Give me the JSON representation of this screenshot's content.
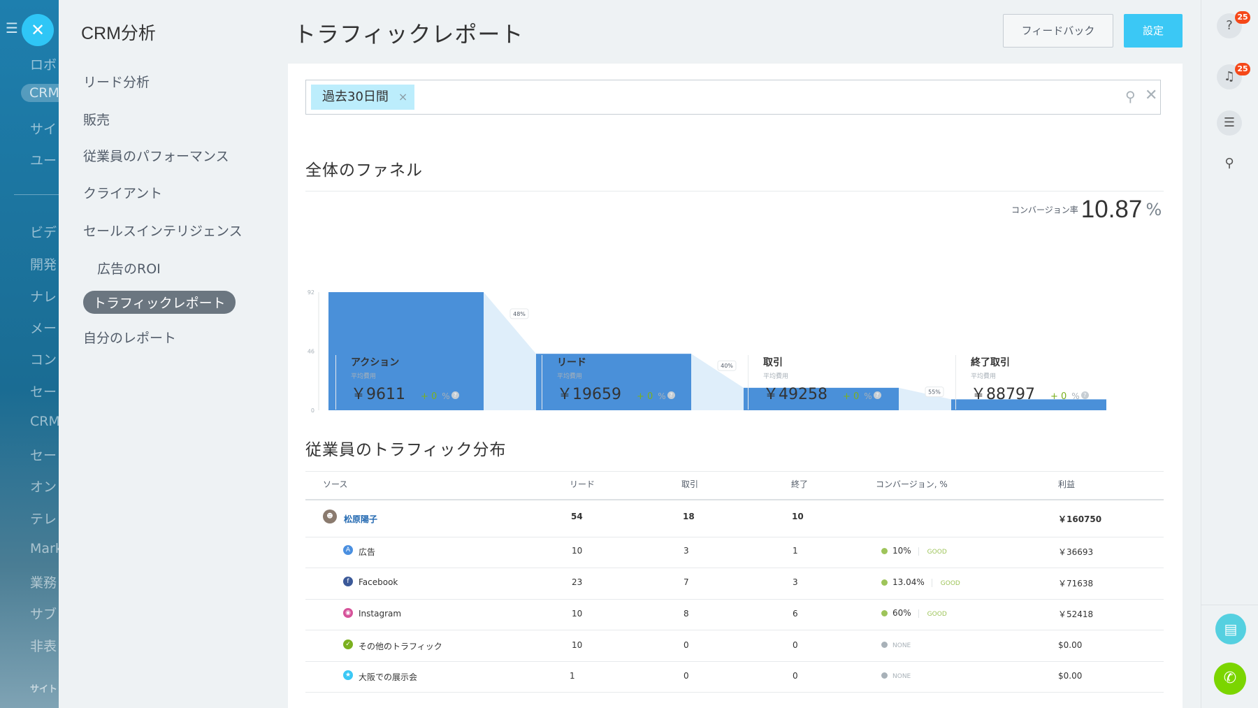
{
  "left_nav": {
    "items": [
      "ロボ",
      "CRM",
      "サイ",
      "ユー",
      "ビデ",
      "開発",
      "ナレ",
      "メー",
      "コン",
      "セー",
      "CRM",
      "セー",
      "オン",
      "テレ",
      "Mark",
      "業務",
      "サブ",
      "非表"
    ],
    "bottom": "サイト"
  },
  "submenu": {
    "title": "CRM分析",
    "items": [
      "リード分析",
      "販売",
      "従業員のパフォーマンス",
      "クライアント",
      "セールスインテリジェンス",
      "広告のROI",
      "トラフィックレポート",
      "自分のレポート"
    ],
    "active": "トラフィックレポート"
  },
  "header": {
    "title": "トラフィックレポート",
    "feedback_label": "フィードバック",
    "settings_label": "設定"
  },
  "right_rail": {
    "help_badge": "25",
    "notifications_badge": "25"
  },
  "filter": {
    "chip_label": "過去30日間",
    "chip_remove": "×"
  },
  "funnel": {
    "section_title": "全体のファネル",
    "conversion_label": "コンバージョン率",
    "conversion_value": "10.87",
    "conversion_unit": "%",
    "stages": [
      {
        "name": "アクション",
        "sub": "平均費用",
        "amount": "￥9611",
        "delta": "+ 0",
        "pct": "%"
      },
      {
        "name": "リード",
        "sub": "平均費用",
        "amount": "￥19659",
        "delta": "+ 0",
        "pct": "%"
      },
      {
        "name": "取引",
        "sub": "平均費用",
        "amount": "￥49258",
        "delta": "+ 0",
        "pct": "%"
      },
      {
        "name": "終了取引",
        "sub": "平均費用",
        "amount": "￥88797",
        "delta": "+ 0",
        "pct": "%"
      }
    ]
  },
  "chart_data": {
    "type": "bar",
    "categories": [
      "アクション",
      "リード",
      "取引",
      "終了取引"
    ],
    "values": [
      92,
      44,
      17.5,
      8.5
    ],
    "ylim": [
      0,
      92
    ],
    "yticks": [
      "92",
      "46",
      "0"
    ],
    "step_labels": [
      "48%",
      "40%",
      "55%"
    ],
    "colors": {
      "bar": "#4a90d9",
      "connector": "#dfeefa"
    },
    "grid": false
  },
  "traffic": {
    "section_title": "従業員のトラフィック分布",
    "headers": [
      "ソース",
      "リード",
      "取引",
      "終了",
      "コンバージョン, %",
      "利益"
    ],
    "employee": {
      "name": "松原陽子",
      "leads": "54",
      "deals": "18",
      "closed": "10",
      "profit": "￥160750"
    },
    "rows": [
      {
        "icon": "ads-icon",
        "color": "#4a8fe0",
        "name": "広告",
        "leads": "10",
        "deals": "3",
        "closed": "1",
        "conv": "10%",
        "grade": "GOOD",
        "profit": "￥36693"
      },
      {
        "icon": "facebook-icon",
        "color": "#3b5998",
        "name": "Facebook",
        "leads": "23",
        "deals": "7",
        "closed": "3",
        "conv": "13.04%",
        "grade": "GOOD",
        "profit": "￥71638"
      },
      {
        "icon": "instagram-icon",
        "color": "#d6529a",
        "name": "Instagram",
        "leads": "10",
        "deals": "8",
        "closed": "6",
        "conv": "60%",
        "grade": "GOOD",
        "profit": "￥52418"
      },
      {
        "icon": "other-traffic-icon",
        "color": "#7bb01f",
        "name": "その他のトラフィック",
        "leads": "10",
        "deals": "0",
        "closed": "0",
        "conv": "",
        "grade": "NONE",
        "profit": "$0.00"
      },
      {
        "icon": "exhibition-icon",
        "color": "#3bc8f5",
        "name": "大阪での展示会",
        "leads": "1",
        "deals": "0",
        "closed": "0",
        "conv": "",
        "grade": "NONE",
        "profit": "$0.00"
      }
    ]
  }
}
